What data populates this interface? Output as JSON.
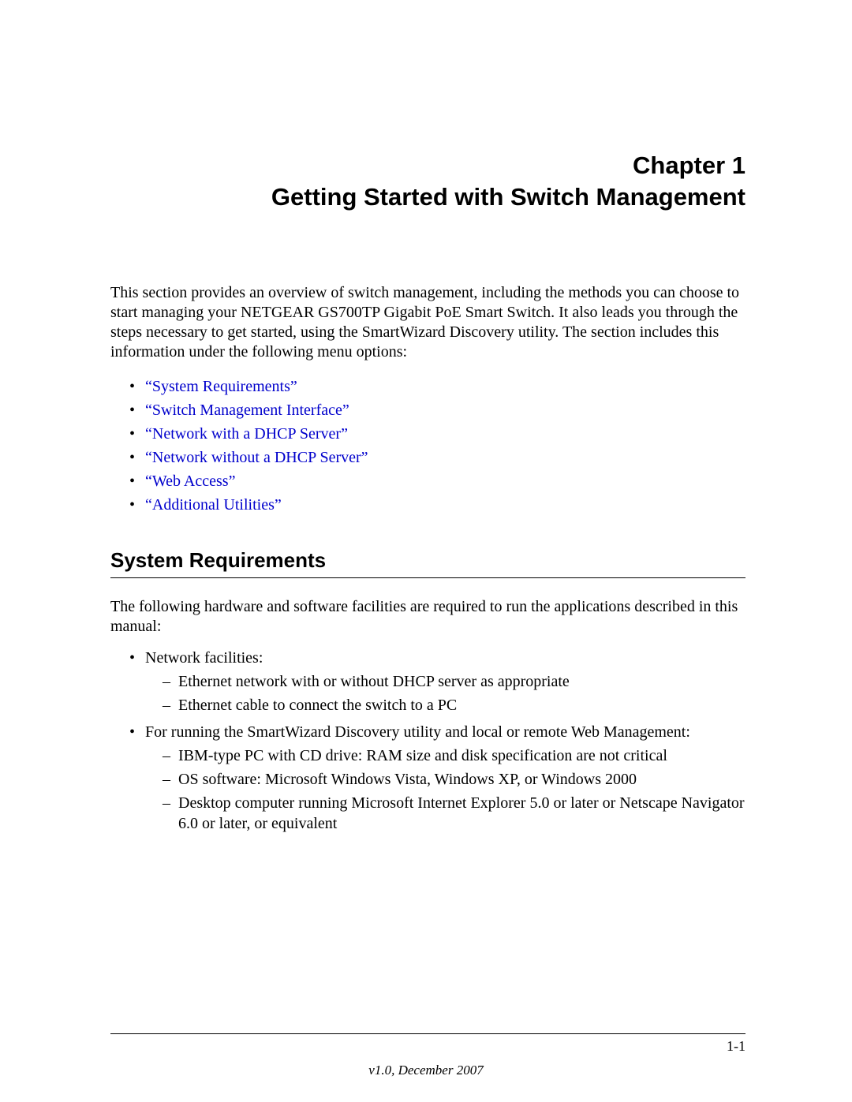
{
  "chapter": {
    "number": "Chapter 1",
    "title": "Getting Started with Switch Management"
  },
  "intro": "This section provides an overview of switch management, including the methods you can choose to start managing your NETGEAR GS700TP Gigabit PoE Smart Switch. It also leads you through the steps necessary to get started, using the SmartWizard Discovery utility. The section includes this information under the following menu options:",
  "toc": [
    "“System Requirements”",
    "“Switch Management Interface”",
    "“Network with a DHCP Server”",
    "“Network without a DHCP Server”",
    "“Web Access”",
    "“Additional Utilities”"
  ],
  "section": {
    "heading": "System Requirements",
    "intro": "The following hardware and software facilities are required to run the applications described in this manual:",
    "items": [
      {
        "label": "Network facilities:",
        "sub": [
          "Ethernet network with or without DHCP server as appropriate",
          "Ethernet cable to connect the switch to a PC"
        ]
      },
      {
        "label": "For running the SmartWizard Discovery utility and local or remote Web Management:",
        "sub": [
          "IBM-type PC with CD drive: RAM size and disk specification are not critical",
          "OS software: Microsoft Windows Vista, Windows XP, or Windows 2000",
          "Desktop computer running Microsoft Internet Explorer 5.0 or later or Netscape Navigator 6.0 or later, or equivalent"
        ]
      }
    ]
  },
  "footer": {
    "page": "1-1",
    "version": "v1.0, December 2007"
  }
}
